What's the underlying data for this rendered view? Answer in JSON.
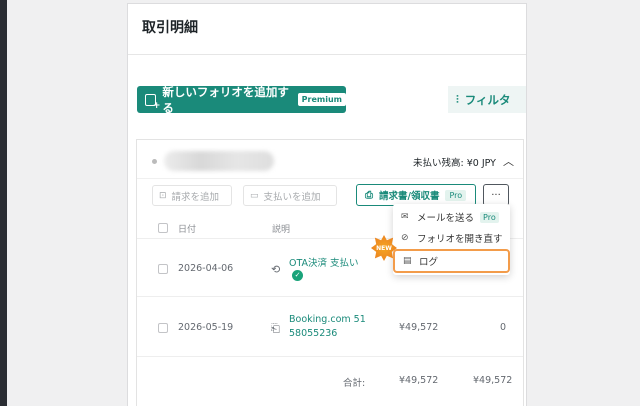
{
  "panel": {
    "title": "取引明細"
  },
  "toolbar": {
    "add_folio_label": "新しいフォリオを追加する",
    "premium_tag": "Premium",
    "filter_label": "フィルタ"
  },
  "folio": {
    "balance_label": "未払い残高: ¥0 JPY",
    "add_request_label": "請求を追加",
    "add_payment_label": "支払いを追加",
    "invoice_label": "請求書/領収書",
    "invoice_pro": "Pro",
    "more_label": "···"
  },
  "table": {
    "headers": {
      "date": "日付",
      "description": "説明"
    },
    "rows": [
      {
        "date": "2026-04-06",
        "description": "OTA決済 支払い",
        "amount": "",
        "balance": ""
      },
      {
        "date": "2026-05-19",
        "description_line1": "Booking.com 51",
        "description_line2": "58055236",
        "amount": "¥49,572",
        "balance": "0"
      }
    ],
    "total": {
      "label": "合計:",
      "amount": "¥49,572",
      "balance": "¥49,572"
    }
  },
  "menu": {
    "send_email": "メールを送る",
    "send_email_pro": "Pro",
    "reopen_folio": "フォリオを開き直す",
    "log": "ログ",
    "new_badge": "NEW"
  },
  "colors": {
    "accent": "#1a8a7a",
    "highlight": "#f39c4a"
  }
}
